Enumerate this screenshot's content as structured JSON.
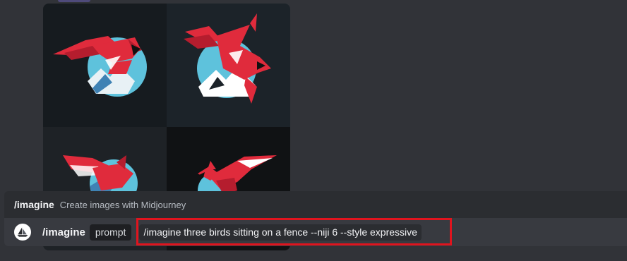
{
  "suggestion": {
    "command": "/imagine",
    "description": "Create images with Midjourney"
  },
  "input": {
    "command": "/imagine",
    "option_name": "prompt",
    "option_value": "/imagine three birds sitting on a fence --niji 6 --style expressive"
  },
  "images": [
    {
      "name": "generated-image-1"
    },
    {
      "name": "generated-image-2"
    },
    {
      "name": "generated-image-3"
    },
    {
      "name": "generated-image-4"
    }
  ],
  "colors": {
    "background": "#313338",
    "highlight": "#e0141e",
    "bird_red": "#e02b3c",
    "sky_blue": "#5ec2dc"
  }
}
